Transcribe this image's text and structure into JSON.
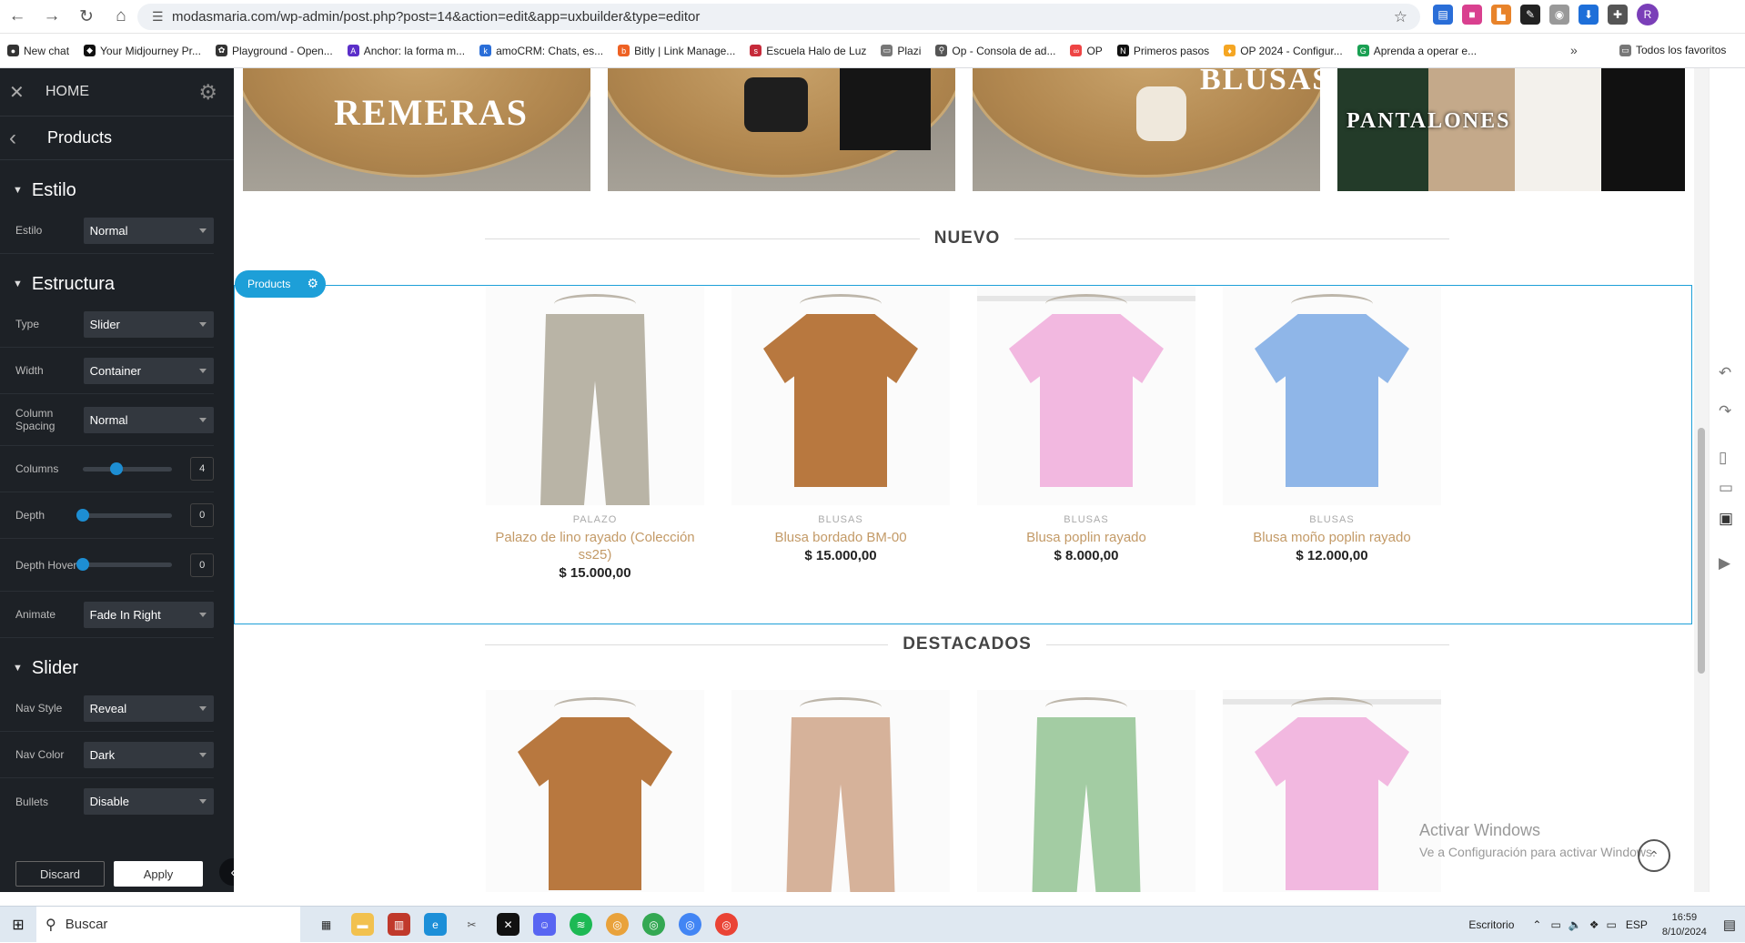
{
  "browser": {
    "url": "modasmaria.com/wp-admin/post.php?post=14&action=edit&app=uxbuilder&type=editor",
    "profile_initial": "R"
  },
  "bookmarks": [
    {
      "label": "New chat",
      "color": "#333"
    },
    {
      "label": "Your Midjourney Pr...",
      "color": "#111"
    },
    {
      "label": "Playground - Open...",
      "color": "#333"
    },
    {
      "label": "Anchor: la forma m...",
      "color": "#5b2fc9"
    },
    {
      "label": "amoCRM: Chats, es...",
      "color": "#2a6ed8"
    },
    {
      "label": "Bitly | Link Manage...",
      "color": "#ee6123"
    },
    {
      "label": "Escuela Halo de Luz",
      "color": "#c62a3a"
    },
    {
      "label": "Plazi",
      "color": "#777"
    },
    {
      "label": "Op - Consola de ad...",
      "color": "#555"
    },
    {
      "label": "OP",
      "color": "#e44"
    },
    {
      "label": "Primeros pasos",
      "color": "#111"
    },
    {
      "label": "OP 2024 - Configur...",
      "color": "#f5a623"
    },
    {
      "label": "Aprenda a operar e...",
      "color": "#1aa053"
    }
  ],
  "bookmarks_more": "»",
  "bookmarks_all": "Todos los favoritos",
  "sidebar": {
    "home": "HOME",
    "title": "Products",
    "sections": {
      "estilo": "Estilo",
      "estructura": "Estructura",
      "slider": "Slider"
    },
    "estilo_label": "Estilo",
    "estilo_value": "Normal",
    "type_label": "Type",
    "type_value": "Slider",
    "width_label": "Width",
    "width_value": "Container",
    "column_spacing_label": "Column Spacing",
    "column_spacing_value": "Normal",
    "columns_label": "Columns",
    "columns_value": "4",
    "columns_fraction": 0.375,
    "depth_label": "Depth",
    "depth_value": "0",
    "depth_hover_label": "Depth Hover",
    "depth_hover_value": "0",
    "animate_label": "Animate",
    "animate_value": "Fade In Right",
    "nav_style_label": "Nav Style",
    "nav_style_value": "Reveal",
    "nav_color_label": "Nav Color",
    "nav_color_value": "Dark",
    "bullets_label": "Bullets",
    "bullets_value": "Disable",
    "discard": "Discard",
    "apply": "Apply"
  },
  "canvas": {
    "categories": [
      "REMERAS",
      "",
      "BLUSAS",
      "PANTALONES"
    ],
    "section_nuevo": "NUEVO",
    "section_destacados": "DESTACADOS",
    "products_tag": "Products",
    "products": [
      {
        "category": "PALAZO",
        "name": "Palazo de lino rayado (Colección ss25)",
        "price": "$ 15.000,00",
        "color": "#b9b4a6",
        "kind": "pants"
      },
      {
        "category": "BLUSAS",
        "name": "Blusa bordado BM-00",
        "price": "$ 15.000,00",
        "color": "#b8783f",
        "kind": "shirt"
      },
      {
        "category": "BLUSAS",
        "name": "Blusa poplin rayado",
        "price": "$ 8.000,00",
        "color": "#f2b8e0",
        "kind": "shirt"
      },
      {
        "category": "BLUSAS",
        "name": "Blusa moño poplin rayado",
        "price": "$ 12.000,00",
        "color": "#8fb6e8",
        "kind": "shirt"
      }
    ],
    "featured": [
      {
        "color": "#b8783f",
        "kind": "shirt"
      },
      {
        "color": "#d6b29a",
        "kind": "pants"
      },
      {
        "color": "#a3cca3",
        "kind": "pants"
      },
      {
        "color": "#f2b8e0",
        "kind": "shirt"
      }
    ]
  },
  "watermark": {
    "line1": "Activar Windows",
    "line2": "Ve a Configuración para activar Windows."
  },
  "taskbar": {
    "search": "Buscar",
    "desktop": "Escritorio",
    "lang": "ESP",
    "time": "16:59",
    "date": "8/10/2024"
  }
}
